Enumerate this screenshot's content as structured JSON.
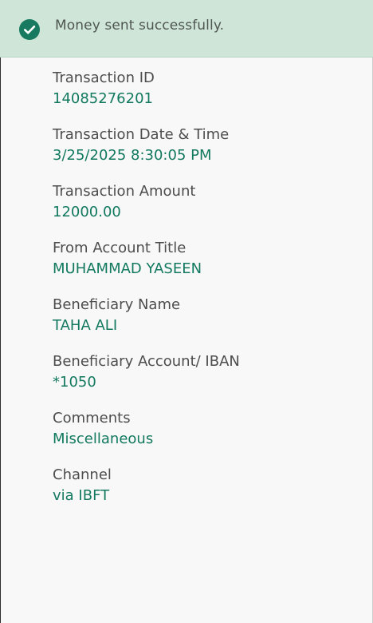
{
  "banner": {
    "message": "Money sent successfully.",
    "icon": "check-circle-icon",
    "background": "#cfe5d7",
    "accent": "#17795f"
  },
  "details": [
    {
      "label": "Transaction ID",
      "value": "14085276201"
    },
    {
      "label": "Transaction Date & Time",
      "value": "3/25/2025 8:30:05 PM"
    },
    {
      "label": "Transaction Amount",
      "value": "12000.00"
    },
    {
      "label": "From Account Title",
      "value": "MUHAMMAD YASEEN"
    },
    {
      "label": "Beneficiary Name",
      "value": "TAHA ALI"
    },
    {
      "label": "Beneficiary Account/ IBAN",
      "value": "*1050"
    },
    {
      "label": "Comments",
      "value": "Miscellaneous"
    },
    {
      "label": "Channel",
      "value": "via IBFT"
    }
  ]
}
